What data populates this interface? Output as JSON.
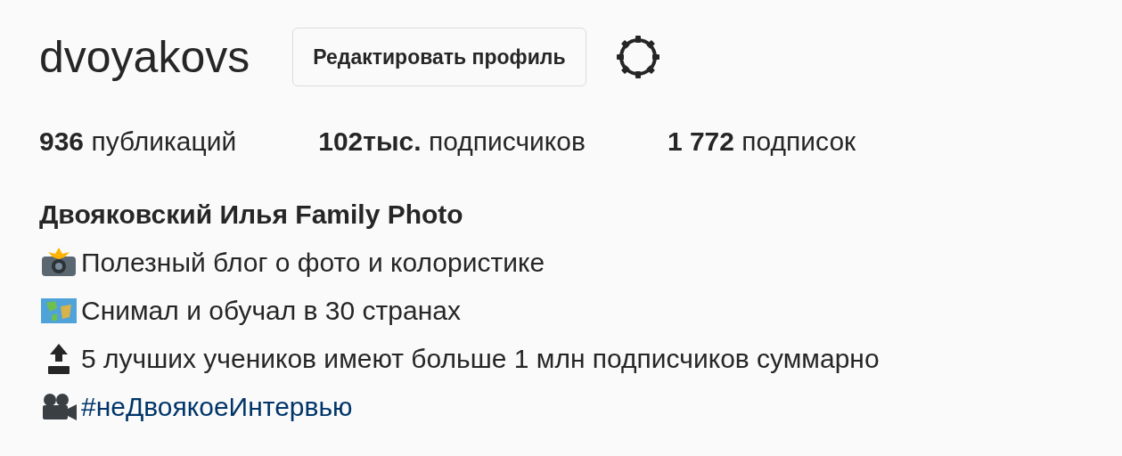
{
  "profile": {
    "username": "dvoyakovs",
    "edit_button": "Редактировать профиль"
  },
  "stats": [
    "**936** публикаций",
    "**102тыс.** подписчиков",
    "**1 772** подписок"
  ],
  "bio": {
    "name": "Двояковский Илья Family Photo",
    "lines": [
      {
        "text": "Полезный блог о фото и колористике",
        "kind": "plain"
      },
      {
        "text": "Снимал и обучал в 30 странах",
        "kind": "plain"
      },
      {
        "text": "5 лучших учеников имеют больше 1 млн подписчиков суммарно",
        "kind": "plain"
      },
      {
        "text": "#неДвоякоеИнтервью",
        "kind": "link"
      }
    ]
  }
}
